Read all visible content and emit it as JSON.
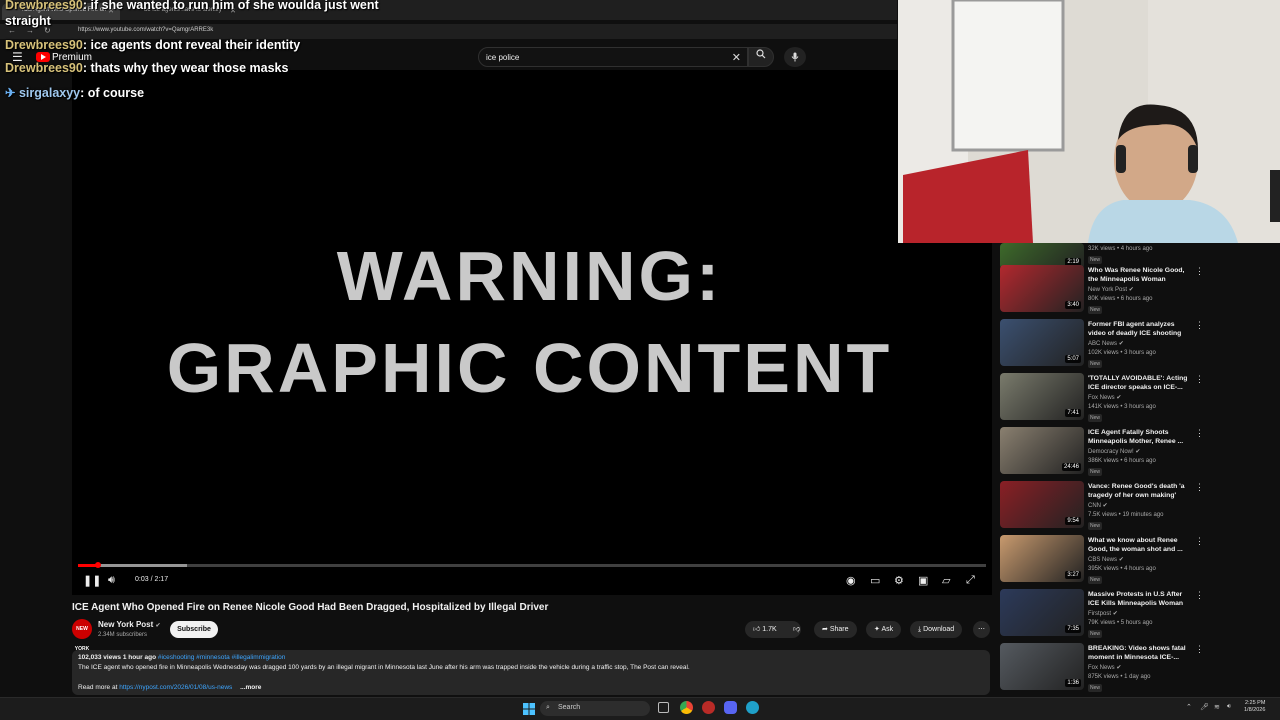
{
  "browser": {
    "tabs": [
      {
        "label": "ICE Agent Who Opened Fire on",
        "active": true
      },
      {
        "label": "do ice agents have to identify",
        "active": false
      }
    ],
    "url": "https://www.youtube.com/watch?v=QamgrARRE3k"
  },
  "yt_header": {
    "brand": "Premium",
    "search_value": "ice police"
  },
  "chat": [
    {
      "user": "Drewbrees90",
      "message": "if she wanted to run him of she woulda just went straight"
    },
    {
      "user": "Drewbrees90",
      "message": "ice agents dont reveal their identity"
    },
    {
      "user": "Drewbrees90",
      "message": "thats why they wear those masks"
    },
    {
      "user": "sirgalaxyy",
      "message": "of course"
    }
  ],
  "player": {
    "line1": "WARNING:",
    "line2": "GRAPHIC CONTENT",
    "time": "0:03 / 2:17",
    "progress_fraction": 0.022,
    "buffered_fraction": 0.12
  },
  "video": {
    "title": "ICE Agent Who Opened Fire on Renee Nicole Good Had Been Dragged, Hospitalized by Illegal Driver",
    "channel": "New York Post",
    "channel_avatar_text": "NEW YORK POST",
    "subscribers": "2.34M subscribers",
    "subscribe_label": "Subscribe",
    "likes": "1.7K",
    "share_label": "Share",
    "ask_label": "Ask",
    "download_label": "Download",
    "views_time": "102,033 views  1 hour ago",
    "tags": "#iceshooting #minnesota #illegalimmigration",
    "description": "The ICE agent who opened fire in Minneapolis Wednesday was dragged 100 yards by an illegal migrant in Minnesota last June after his arm was trapped inside the vehicle during a traffic stop, The Post can reveal.",
    "read_more_prefix": "Read more at",
    "read_more_link": "https://nypost.com/2026/01/08/us-news",
    "more_label": "...more"
  },
  "recommendations": [
    {
      "title": "",
      "channel": "",
      "views": "32K views • 4 hours ago",
      "new": "New",
      "duration": "2:19",
      "color": "#3d6a2a"
    },
    {
      "title": "Who Was Renee Nicole Good, the Minneapolis Woman Killed...",
      "channel": "New York Post",
      "views": "80K views • 6 hours ago",
      "new": "New",
      "duration": "3:40",
      "color": "#b2282e"
    },
    {
      "title": "Former FBI agent analyzes video of deadly ICE shooting i...",
      "channel": "ABC News",
      "views": "102K views • 3 hours ago",
      "new": "New",
      "duration": "5:07",
      "color": "#3b5070"
    },
    {
      "title": "'TOTALLY AVOIDABLE': Acting ICE director speaks on ICE-...",
      "channel": "Fox News",
      "views": "141K views • 3 hours ago",
      "new": "New",
      "duration": "7:41",
      "color": "#7a7b6c"
    },
    {
      "title": "ICE Agent Fatally Shoots Minneapolis Mother, Renee ...",
      "channel": "Democracy Now!",
      "views": "386K views • 6 hours ago",
      "new": "New",
      "duration": "24:46",
      "color": "#8a8070"
    },
    {
      "title": "Vance: Renee Good's death 'a tragedy of her own making'",
      "channel": "CNN",
      "views": "7.5K views • 19 minutes ago",
      "new": "New",
      "duration": "9:54",
      "color": "#8a1f25"
    },
    {
      "title": "What we know about Renee Good, the woman shot and ...",
      "channel": "CBS News",
      "views": "395K views • 4 hours ago",
      "new": "New",
      "duration": "3:27",
      "color": "#c89a6e"
    },
    {
      "title": "Massive Protests in U.S After ICE Kills Minneapolis Woman |...",
      "channel": "Firstpost",
      "views": "79K views • 5 hours ago",
      "new": "New",
      "duration": "7:35",
      "color": "#2c3a5a"
    },
    {
      "title": "BREAKING: Video shows fatal moment in Minnesota ICE-...",
      "channel": "Fox News",
      "views": "875K views • 1 day ago",
      "new": "New",
      "duration": "1:36",
      "color": "#555a60"
    }
  ],
  "taskbar": {
    "search_label": "Search",
    "time": "2:25 PM",
    "date": "1/8/2026"
  }
}
